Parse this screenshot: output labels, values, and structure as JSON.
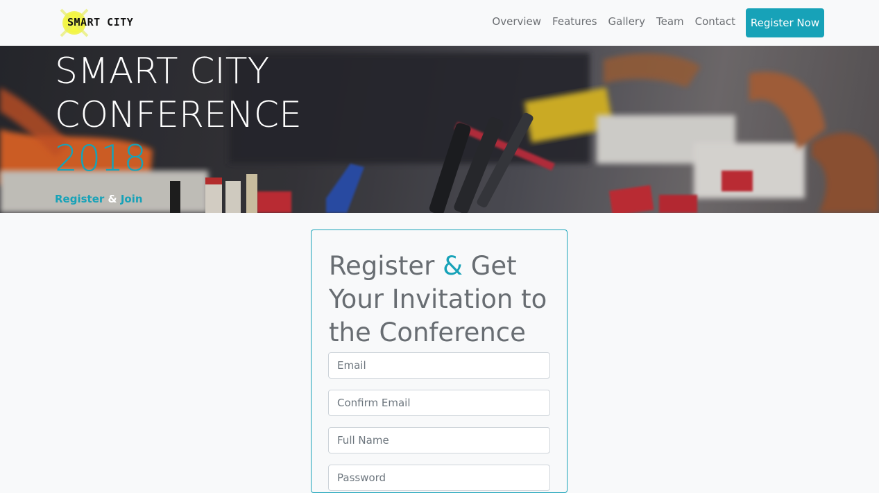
{
  "brand": {
    "text": "SMART CITY"
  },
  "nav": {
    "links": [
      "Overview",
      "Features",
      "Gallery",
      "Team",
      "Contact"
    ],
    "cta": "Register Now"
  },
  "hero": {
    "line1": "SMART CITY",
    "line2": "CONFERENCE",
    "year": "2018",
    "sub_register": "Register",
    "sub_amp": "&",
    "sub_join": "Join"
  },
  "form": {
    "title_part1": "Register ",
    "title_amp": "&",
    "title_part2": " Get Your Invitation to the Conference",
    "email_placeholder": "Email",
    "confirm_email_placeholder": "Confirm Email",
    "full_name_placeholder": "Full Name",
    "password_placeholder": "Password"
  },
  "colors": {
    "accent": "#17a2b8",
    "background": "#f8f9fa",
    "text_muted": "#686d72"
  }
}
